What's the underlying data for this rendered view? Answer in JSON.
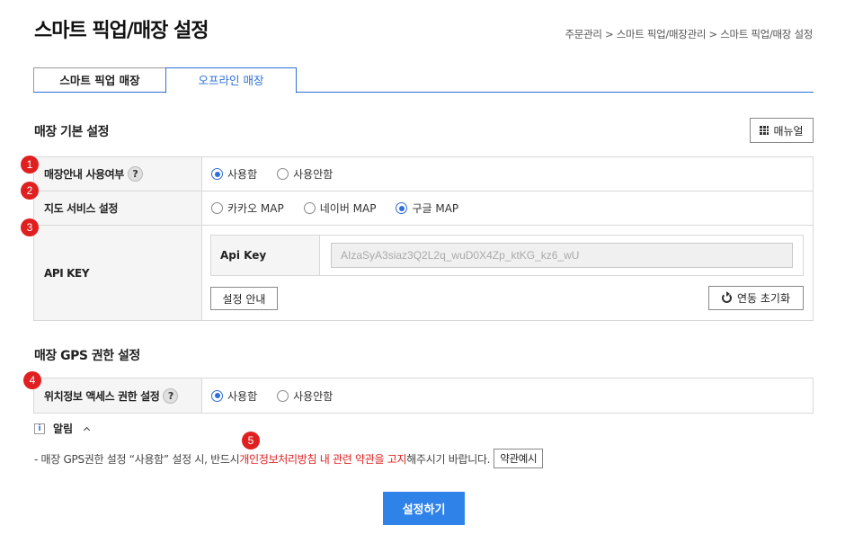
{
  "page_title": "스마트 픽업/매장 설정",
  "breadcrumb": "주문관리 > 스마트 픽업/매장관리 > 스마트 픽업/매장 설정",
  "tabs": [
    {
      "label": "스마트 픽업 매장"
    },
    {
      "label": "오프라인 매장"
    }
  ],
  "basic": {
    "title": "매장 기본 설정",
    "manual_label": "매뉴얼",
    "guide": {
      "label": "매장안내 사용여부",
      "options": [
        "사용함",
        "사용안함"
      ],
      "selected": "사용함"
    },
    "map": {
      "label": "지도 서비스 설정",
      "options": [
        "카카오 MAP",
        "네이버 MAP",
        "구글 MAP"
      ],
      "selected": "구글 MAP"
    },
    "api": {
      "label": "API KEY",
      "inner_label": "Api Key",
      "value": "AIzaSyA3siaz3Q2L2q_wuD0X4Zp_ktKG_kz6_wU",
      "guide_button": "설정 안내",
      "reset_button": "연동 초기화"
    }
  },
  "gps": {
    "title": "매장 GPS 권한 설정",
    "label": "위치정보 액세스 권한 설정",
    "options": [
      "사용함",
      "사용안함"
    ],
    "selected": "사용함"
  },
  "notice": {
    "title": "알림",
    "text_before": "- 매장 GPS권한 설정 “사용함” 설정 시, 반드시 ",
    "text_highlight": "개인정보처리방침 내 관련 약관을 고지",
    "text_after": "해주시기 바랍니다.",
    "terms_button": "약관예시"
  },
  "submit_label": "설정하기",
  "markers": [
    "1",
    "2",
    "3",
    "4",
    "5"
  ],
  "colors": {
    "accent": "#2f83e8",
    "marker": "#e02020",
    "tab_active": "#2f6fd8"
  }
}
